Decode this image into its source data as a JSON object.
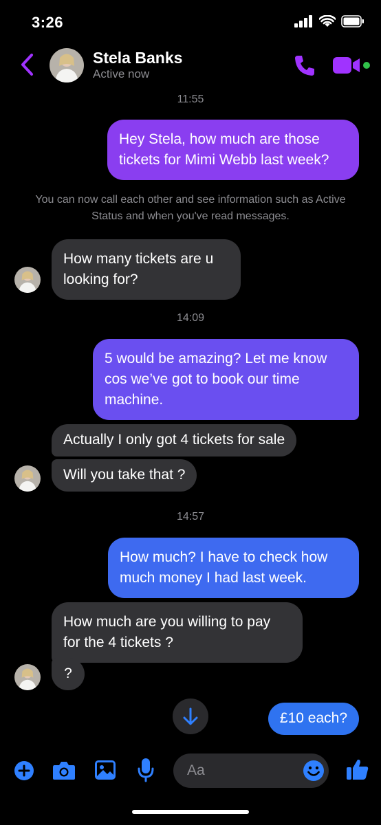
{
  "status_bar": {
    "time": "3:26"
  },
  "header": {
    "contact_name": "Stela Banks",
    "contact_status": "Active now"
  },
  "messages": [
    {
      "type": "timestamp",
      "text": "11:55"
    },
    {
      "type": "outgoing",
      "text": "Hey Stela, how much are those tickets for Mimi Webb last week?",
      "color": "#8a3ef0"
    },
    {
      "type": "system",
      "text": "You can now call each other and see information such as Active Status and when you've read messages."
    },
    {
      "type": "incoming",
      "text": "How many tickets are u looking for?"
    },
    {
      "type": "timestamp",
      "text": "14:09"
    },
    {
      "type": "outgoing",
      "text": "5 would be amazing? Let me know cos we’ve got to book our time machine.",
      "color": "#6a4ff0"
    },
    {
      "type": "incoming",
      "text": "Actually I only got 4 tickets for sale"
    },
    {
      "type": "incoming",
      "text": "Will you take that ?"
    },
    {
      "type": "timestamp",
      "text": "14:57"
    },
    {
      "type": "outgoing",
      "text": "How much? I have to check how much money I had last week.",
      "color": "#3e6af0"
    },
    {
      "type": "incoming",
      "text": "How much are you willing to pay for the 4 tickets ?"
    },
    {
      "type": "incoming",
      "text": "?"
    },
    {
      "type": "outgoing",
      "text": "£10 each?",
      "color": "#2f73f0"
    }
  ],
  "composer": {
    "placeholder": "Aa"
  },
  "colors": {
    "accent_purple": "#a033ff",
    "accent_blue": "#2f80ff",
    "online": "#31c24a"
  },
  "icons": [
    "back-chevron-icon",
    "phone-icon",
    "video-camera-icon",
    "arrow-down-icon",
    "plus-icon",
    "camera-icon",
    "image-icon",
    "microphone-icon",
    "emoji-icon",
    "thumbs-up-icon"
  ]
}
